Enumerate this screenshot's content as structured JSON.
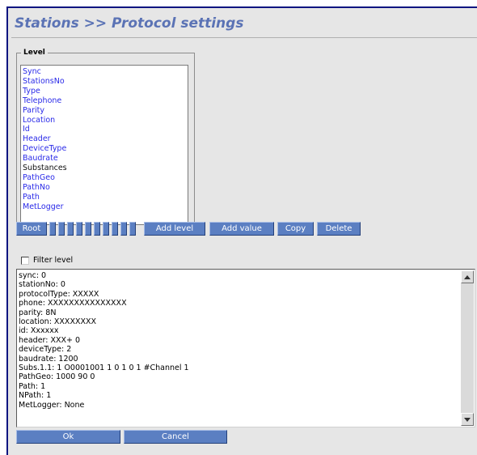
{
  "header": {
    "title": "Stations >> Protocol settings"
  },
  "level": {
    "legend": "Level",
    "items": [
      {
        "label": "Sync",
        "style": "link"
      },
      {
        "label": "StationsNo",
        "style": "link"
      },
      {
        "label": "Type",
        "style": "link"
      },
      {
        "label": "Telephone",
        "style": "link"
      },
      {
        "label": "Parity",
        "style": "link"
      },
      {
        "label": "Location",
        "style": "link"
      },
      {
        "label": "Id",
        "style": "link"
      },
      {
        "label": "Header",
        "style": "link"
      },
      {
        "label": "DeviceType",
        "style": "link"
      },
      {
        "label": "Baudrate",
        "style": "link"
      },
      {
        "label": "Substances",
        "style": "plain"
      },
      {
        "label": "PathGeo",
        "style": "link"
      },
      {
        "label": "PathNo",
        "style": "link"
      },
      {
        "label": "Path",
        "style": "link"
      },
      {
        "label": "MetLogger",
        "style": "link"
      }
    ]
  },
  "toolbar": {
    "root_label": "Root",
    "add_level_label": "Add level",
    "add_value_label": "Add value",
    "copy_label": "Copy",
    "delete_label": "Delete"
  },
  "filter": {
    "label": "Filter level",
    "checked": false
  },
  "settings_text": [
    "sync: 0",
    "stationNo: 0",
    "protocolType: XXXXX",
    "phone: XXXXXXXXXXXXXXX",
    "parity: 8N",
    "location: XXXXXXXX",
    "id: Xxxxxx",
    "header: XXX+ 0",
    "deviceType: 2",
    "baudrate: 1200",
    "Subs.1.1: 1 O0001001 1 0 1 0 1 #Channel 1",
    "PathGeo: 1000 90 0",
    "Path: 1",
    "NPath: 1",
    "MetLogger: None"
  ],
  "footer": {
    "ok_label": "Ok",
    "cancel_label": "Cancel"
  },
  "colors": {
    "title": "#5b73b5",
    "button": "#5b7fc2",
    "link": "#2a2ae8",
    "border": "#0c1580"
  },
  "icons": {
    "scroll_up": "triangle-up-icon",
    "scroll_down": "triangle-down-icon"
  }
}
